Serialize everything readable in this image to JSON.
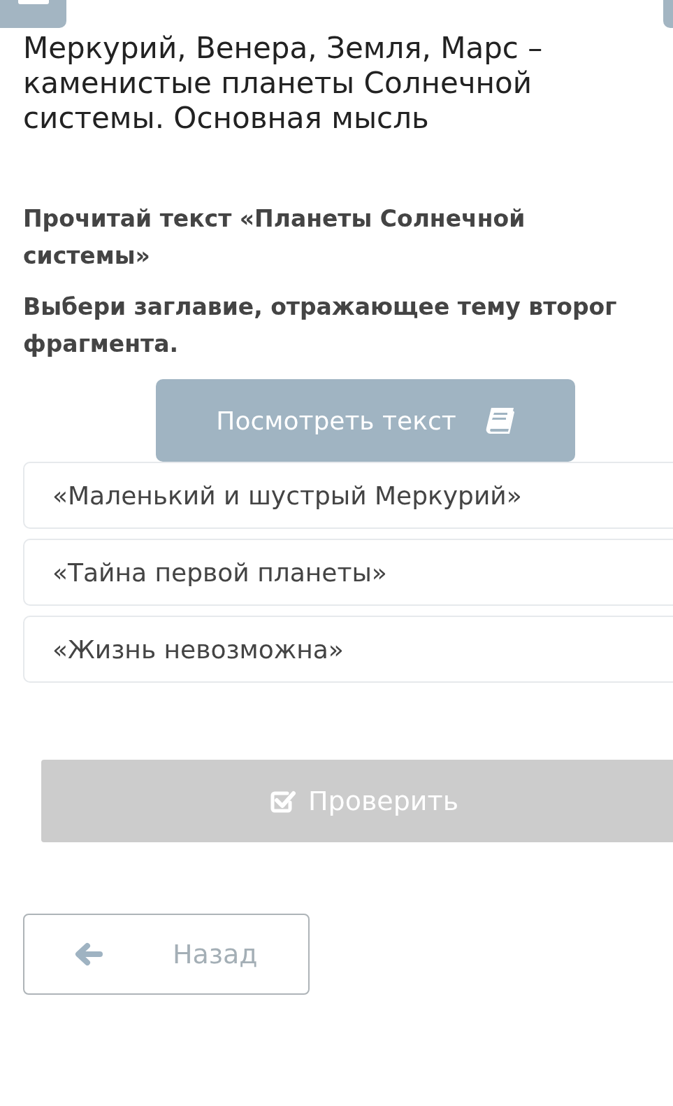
{
  "title": "Меркурий, Венера, Земля, Марс – каменистые планеты Солнечной системы. Основная мысль",
  "task": "Прочитай текст «Планеты Солнечной системы»",
  "instruction": "Выбери заглавие, отражающее тему второг\nфрагмента.",
  "view_text_button": "Посмотреть текст",
  "options": [
    {
      "label": "«Маленький и шустрый Меркурий»",
      "selected": false
    },
    {
      "label": "«Тайна первой планеты»",
      "selected": false
    },
    {
      "label": "«Жизнь невозможна»",
      "selected": false
    }
  ],
  "check_button": {
    "label": "Проверить",
    "disabled": true
  },
  "back_button": "Назад"
}
